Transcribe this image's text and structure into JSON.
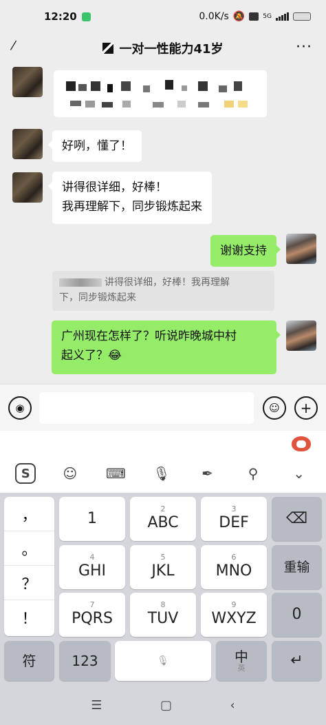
{
  "status": {
    "time": "12:20",
    "net_speed": "0.0K/s",
    "network": "5G"
  },
  "header": {
    "title": "一对一性能力41岁",
    "more": "···"
  },
  "messages": [
    {
      "side": "in",
      "text": "好咧，懂了！"
    },
    {
      "side": "in",
      "lines": [
        "讲得很详细，好棒！",
        "我再理解下，同步锻炼起来"
      ]
    },
    {
      "side": "out",
      "text": "谢谢支持"
    },
    {
      "side": "out",
      "lines": [
        "广州现在怎样了？听说昨晚城中村",
        "起义了？😂"
      ]
    }
  ],
  "quote": {
    "text": "讲得很详细，好棒！我再理解",
    "text2": "下，同步锻炼起来"
  },
  "ime": {
    "symbols": [
      "，",
      "。",
      "？",
      "！"
    ],
    "keys": [
      {
        "main": "1",
        "sub": ""
      },
      {
        "main": "ABC",
        "sub": "2"
      },
      {
        "main": "DEF",
        "sub": "3"
      },
      {
        "main": "GHI",
        "sub": "4"
      },
      {
        "main": "JKL",
        "sub": "5"
      },
      {
        "main": "MNO",
        "sub": "6"
      },
      {
        "main": "PQRS",
        "sub": "7"
      },
      {
        "main": "TUV",
        "sub": "8"
      },
      {
        "main": "WXYZ",
        "sub": "9"
      }
    ],
    "retype": "重输",
    "zero": "0",
    "symbol_key": "符",
    "num_key": "123",
    "lang_main": "中",
    "lang_sub": "英"
  },
  "colors": {
    "outgoing_bubble": "#95ec69",
    "incoming_bubble": "#ffffff",
    "chat_bg": "#ededed"
  }
}
